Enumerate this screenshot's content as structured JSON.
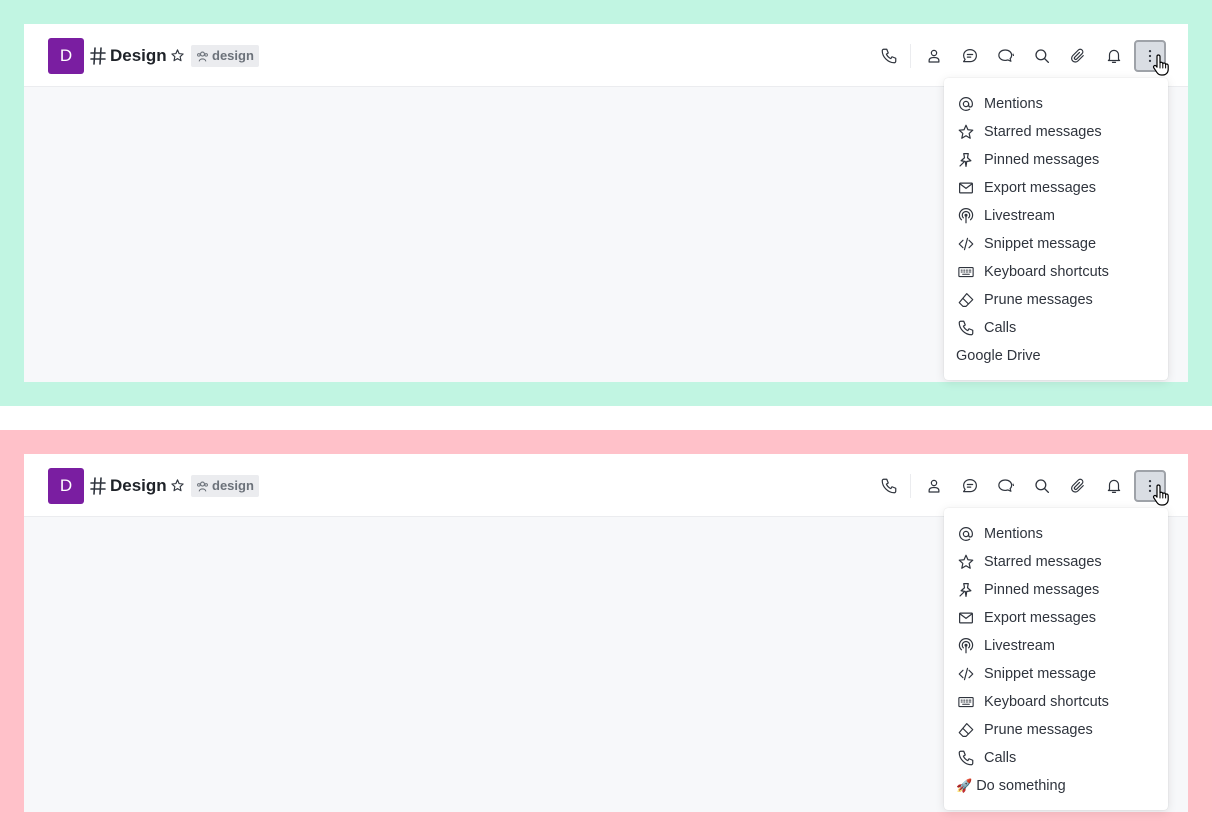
{
  "colors": {
    "top_band": "#c1f5e2",
    "bottom_band": "#ffc1c9",
    "avatar_bg": "#7a1ea1"
  },
  "panels": [
    {
      "avatar_letter": "D",
      "room_title": "Design",
      "tag_label": "design",
      "menu": {
        "items": [
          {
            "label": "Mentions",
            "icon": "at-icon"
          },
          {
            "label": "Starred messages",
            "icon": "star-icon"
          },
          {
            "label": "Pinned messages",
            "icon": "pin-icon"
          },
          {
            "label": "Export messages",
            "icon": "mail-icon"
          },
          {
            "label": "Livestream",
            "icon": "broadcast-icon"
          },
          {
            "label": "Snippet message",
            "icon": "code-icon"
          },
          {
            "label": "Keyboard shortcuts",
            "icon": "keyboard-icon"
          },
          {
            "label": "Prune messages",
            "icon": "eraser-icon"
          },
          {
            "label": "Calls",
            "icon": "phone-icon"
          }
        ],
        "extra_item": "Google Drive"
      }
    },
    {
      "avatar_letter": "D",
      "room_title": "Design",
      "tag_label": "design",
      "menu": {
        "items": [
          {
            "label": "Mentions",
            "icon": "at-icon"
          },
          {
            "label": "Starred messages",
            "icon": "star-icon"
          },
          {
            "label": "Pinned messages",
            "icon": "pin-icon"
          },
          {
            "label": "Export messages",
            "icon": "mail-icon"
          },
          {
            "label": "Livestream",
            "icon": "broadcast-icon"
          },
          {
            "label": "Snippet message",
            "icon": "code-icon"
          },
          {
            "label": "Keyboard shortcuts",
            "icon": "keyboard-icon"
          },
          {
            "label": "Prune messages",
            "icon": "eraser-icon"
          },
          {
            "label": "Calls",
            "icon": "phone-icon"
          }
        ],
        "extra_item_emoji": "🚀",
        "extra_item": "Do something"
      }
    }
  ],
  "toolbar_icons": [
    "phone-icon",
    "user-icon",
    "discussion-icon",
    "threads-icon",
    "search-icon",
    "clip-icon",
    "bell-icon",
    "kebab-icon"
  ]
}
